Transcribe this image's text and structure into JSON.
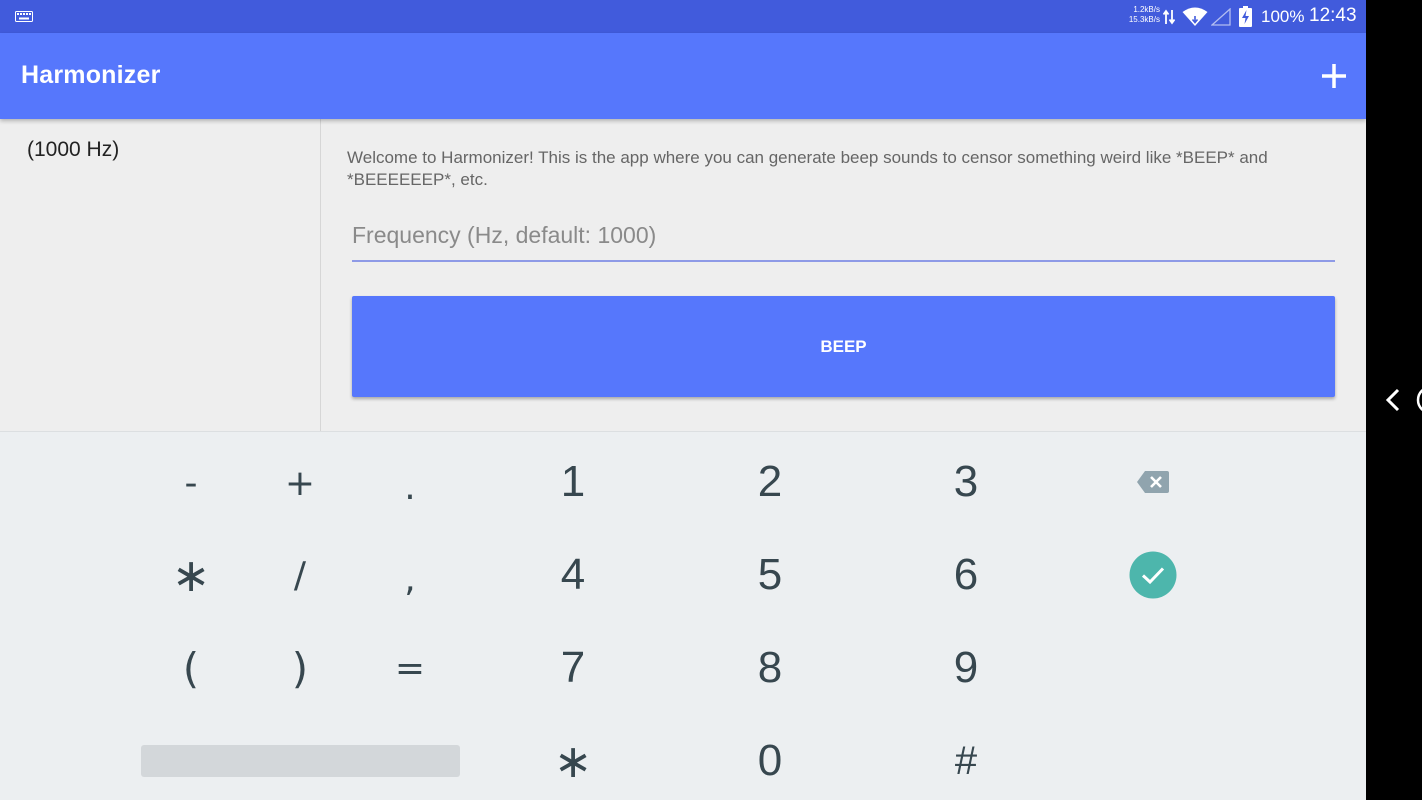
{
  "status_bar": {
    "net_speed_up": "1.2kB/s",
    "net_speed_down": "15.3kB/s",
    "battery_percent": "100%",
    "time": "12:43",
    "icons": [
      "keyboard-icon",
      "data-transfer-icon",
      "wifi-icon",
      "cell-signal-icon",
      "battery-charging-icon"
    ]
  },
  "app_bar": {
    "title": "Harmonizer",
    "action_icon": "add-icon"
  },
  "list": {
    "items": [
      {
        "label": "(1000 Hz)"
      }
    ]
  },
  "detail": {
    "welcome_text": "Welcome to Harmonizer! This is the app where you can generate beep sounds to censor something weird like *BEEP* and *BEEEEEEP*, etc.",
    "frequency_placeholder": "Frequency (Hz, default: 1000)",
    "frequency_value": "",
    "beep_label": "BEEP"
  },
  "keyboard": {
    "rows": [
      [
        "-",
        "+",
        ".",
        "1",
        "2",
        "3",
        "backspace"
      ],
      [
        "∗",
        "/",
        ",",
        "4",
        "5",
        "6",
        "done"
      ],
      [
        "(",
        ")",
        "=",
        "7",
        "8",
        "9",
        ""
      ],
      [
        "space",
        "∗",
        "0",
        "#"
      ]
    ],
    "keys": {
      "minus": "-",
      "plus": "+",
      "period": ".",
      "one": "1",
      "two": "2",
      "three": "3",
      "asterisk": "∗",
      "slash": "/",
      "comma": ",",
      "four": "4",
      "five": "5",
      "six": "6",
      "lparen": "(",
      "rparen": ")",
      "equals": "=",
      "seven": "7",
      "eight": "8",
      "nine": "9",
      "star": "∗",
      "zero": "0",
      "hash": "#"
    }
  },
  "colors": {
    "status_bar": "#415bdc",
    "app_bar": "#5677fc",
    "button": "#5677fc",
    "keyboard_bg": "#eceff1",
    "key_text": "#37474f",
    "done_key": "#4db6ac"
  },
  "nav": {
    "icons": [
      "back-icon",
      "home-icon"
    ]
  }
}
